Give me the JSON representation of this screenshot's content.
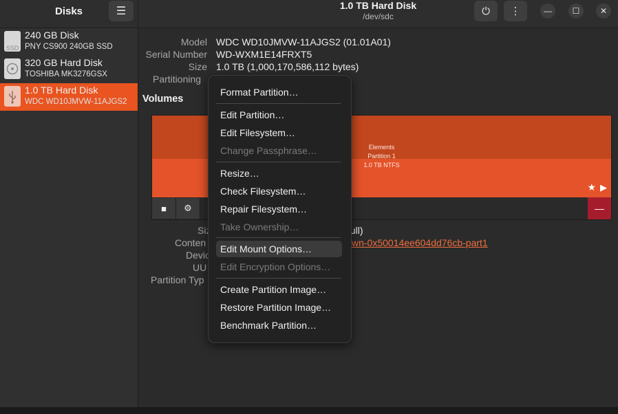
{
  "app": {
    "title": "Disks",
    "menu_icon": "hamburger-menu-icon"
  },
  "header": {
    "title": "1.0 TB Hard Disk",
    "subtitle": "/dev/sdc"
  },
  "sidebar": {
    "disks": [
      {
        "name": "240 GB Disk",
        "model": "PNY CS900 240GB SSD",
        "icon": "ssd-icon",
        "icon_text": "SSD"
      },
      {
        "name": "320 GB Hard Disk",
        "model": "TOSHIBA MK3276GSX",
        "icon": "hard-disk-icon",
        "icon_text": ""
      },
      {
        "name": "1.0 TB Hard Disk",
        "model": "WDC WD10JMVW-11AJGS2",
        "icon": "usb-drive-icon",
        "icon_text": ""
      }
    ],
    "selected_index": 2
  },
  "drive_info": {
    "model_label": "Model",
    "model_value": "WDC WD10JMVW-11AJGS2 (01.01A01)",
    "serial_label": "Serial Number",
    "serial_value": "WD-WXM1E14FRXT5",
    "size_label": "Size",
    "size_value": "1.0 TB (1,000,170,586,112 bytes)",
    "partitioning_label": "Partitioning"
  },
  "volumes": {
    "title": "Volumes",
    "partition": {
      "name": "Elements",
      "number": "Partition 1",
      "size": "1.0 TB NTFS"
    }
  },
  "volume_details": {
    "size_label": "Siz",
    "size_value_fragment": "full)",
    "contents_label": "Conten",
    "device_label": "Devic",
    "uuid_label": "UU",
    "partition_type_label": "Partition Typ",
    "link_fragment": "wn-0x50014ee604dd76cb-part1"
  },
  "popup_menu": {
    "items": [
      {
        "label": "Format Partition…",
        "disabled": false
      },
      {
        "label": "Edit Partition…",
        "disabled": false
      },
      {
        "label": "Edit Filesystem…",
        "disabled": false
      },
      {
        "label": "Change Passphrase…",
        "disabled": true
      },
      {
        "label": "Resize…",
        "disabled": false
      },
      {
        "label": "Check Filesystem…",
        "disabled": false
      },
      {
        "label": "Repair Filesystem…",
        "disabled": false
      },
      {
        "label": "Take Ownership…",
        "disabled": true
      },
      {
        "label": "Edit Mount Options…",
        "disabled": false,
        "hover": true
      },
      {
        "label": "Edit Encryption Options…",
        "disabled": true
      },
      {
        "label": "Create Partition Image…",
        "disabled": false
      },
      {
        "label": "Restore Partition Image…",
        "disabled": false
      },
      {
        "label": "Benchmark Partition…",
        "disabled": false
      }
    ]
  },
  "colors": {
    "accent": "#e95420",
    "partition_top": "#c2471e",
    "partition_bottom": "#e4532a",
    "delete": "#a51d2d"
  }
}
